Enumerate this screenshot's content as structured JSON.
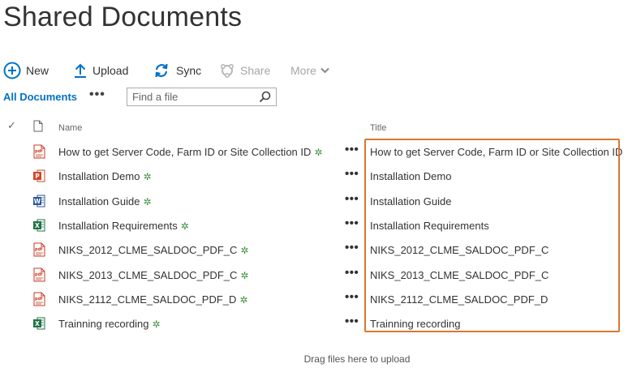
{
  "page": {
    "title": "Shared Documents"
  },
  "toolbar": {
    "new_label": "New",
    "upload_label": "Upload",
    "sync_label": "Sync",
    "share_label": "Share",
    "more_label": "More",
    "accent": "#0072c6",
    "disabled_color": "#a6a6a6"
  },
  "views": {
    "all_documents_label": "All Documents",
    "ellipsis": "•••",
    "search_placeholder": "Find a file"
  },
  "list": {
    "columns": {
      "check": "✓",
      "name": "Name",
      "title": "Title"
    },
    "rows": [
      {
        "icon": "pdf-file-icon",
        "name": "How to get Server Code, Farm ID or Site Collection ID",
        "title": "How to get Server Code, Farm ID or Site Collection ID",
        "is_new": true,
        "menu": "•••"
      },
      {
        "icon": "powerpoint-file-icon",
        "name": "Installation Demo",
        "title": "Installation Demo",
        "is_new": true,
        "menu": "•••"
      },
      {
        "icon": "word-file-icon",
        "name": "Installation Guide",
        "title": "Installation Guide",
        "is_new": true,
        "menu": "•••"
      },
      {
        "icon": "excel-file-icon",
        "name": "Installation Requirements",
        "title": "Installation Requirements",
        "is_new": true,
        "menu": "•••"
      },
      {
        "icon": "pdf-file-icon",
        "name": "NIKS_2012_CLME_SALDOC_PDF_C",
        "title": "NIKS_2012_CLME_SALDOC_PDF_C",
        "is_new": true,
        "menu": "•••"
      },
      {
        "icon": "pdf-file-icon",
        "name": "NIKS_2013_CLME_SALDOC_PDF_C",
        "title": "NIKS_2013_CLME_SALDOC_PDF_C",
        "is_new": true,
        "menu": "•••"
      },
      {
        "icon": "pdf-file-icon",
        "name": "NIKS_2112_CLME_SALDOC_PDF_D",
        "title": "NIKS_2112_CLME_SALDOC_PDF_D",
        "is_new": true,
        "menu": "•••"
      },
      {
        "icon": "excel-file-icon",
        "name": "Trainning recording",
        "title": "Trainning recording",
        "is_new": true,
        "menu": "•••"
      }
    ]
  },
  "new_badge": "✲",
  "drop_hint": "Drag files here to upload",
  "colors": {
    "highlight_border": "#d9782f",
    "new_badge": "#3e8f3e",
    "pdf": "#c8381f",
    "powerpoint": "#d24726",
    "word": "#2b579a",
    "excel": "#217346"
  }
}
